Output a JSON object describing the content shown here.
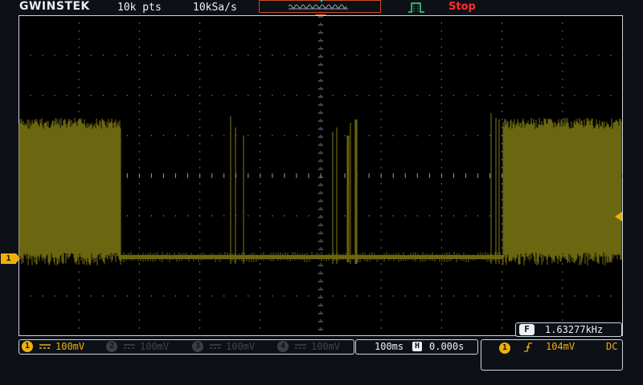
{
  "header": {
    "brand": "GWINSTEK",
    "record_length": "10k pts",
    "sample_rate": "10kSa/s",
    "run_status": "Stop",
    "status_color": "#ff2e2e"
  },
  "memory_bar": {
    "icon": "memory-wave-icon",
    "view_position": 0.5
  },
  "trigger_icon": "trigger-rising-icon",
  "display": {
    "grid": {
      "h_divs": 10,
      "v_divs": 8
    },
    "trace_color": "#6b6610",
    "channel_color": "#f0b00a",
    "ch1_marker": "1"
  },
  "measurement": {
    "badge": "F",
    "frequency": "1.63277kHz"
  },
  "channels": [
    {
      "num": "1",
      "scale": "100mV",
      "active": true
    },
    {
      "num": "2",
      "scale": "100mV",
      "active": false
    },
    {
      "num": "3",
      "scale": "100mV",
      "active": false
    },
    {
      "num": "4",
      "scale": "100mV",
      "active": false
    }
  ],
  "timebase": {
    "scale": "100ms",
    "h_badge": "H",
    "position": "0.000s"
  },
  "trigger": {
    "source": "1",
    "slope_icon": "rising-edge-icon",
    "level": "104mV",
    "coupling": "DC"
  }
}
